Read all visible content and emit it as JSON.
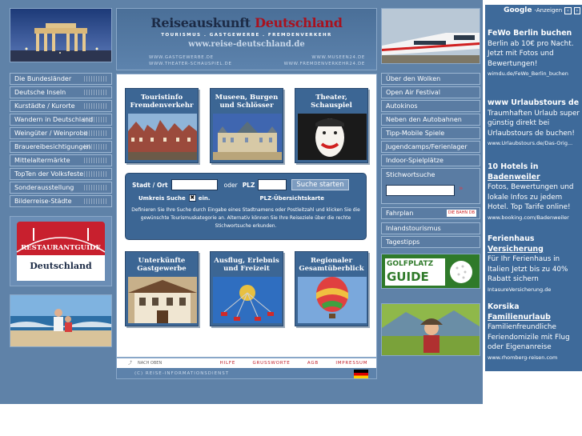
{
  "header": {
    "title_part1": "Reiseauskunft",
    "title_part2": "Deutschland",
    "subtitle": "TOURISMUS . GASTGEWERBE . FREMDENVERKEHR",
    "url": "www.reise-deutschland.de",
    "links": [
      "WWW.GASTGEWERBE.DE",
      "WWW.MUSEEN24.DE",
      "WWW.THEATER-SCHAUSPIEL.DE",
      "WWW.FREMDENVERKEHR24.DE"
    ]
  },
  "left_nav": [
    "Die Bundesländer",
    "Deutsche Inseln",
    "Kurstädte / Kurorte",
    "Wandern in Deutschland",
    "Weingüter / Weinprobe",
    "Brauereibesichtigungen",
    "Mittelaltermärkte",
    "TopTen der Volksfeste",
    "Sonderausstellung",
    "Bilderreise-Städte"
  ],
  "restaurant_guide": {
    "line1": "Restaurantguide",
    "line2": "Deutschland"
  },
  "tiles_top": [
    {
      "title": "Touristinfo Fremdenverkehr"
    },
    {
      "title": "Museen, Burgen und Schlösser"
    },
    {
      "title": "Theater, Schauspiel"
    }
  ],
  "tiles_bottom": [
    {
      "title": "Unterkünfte Gastgewerbe"
    },
    {
      "title": "Ausflug, Erlebnis und Freizeit"
    },
    {
      "title": "Regionaler Gesamtüberblick"
    }
  ],
  "search": {
    "city_label": "Stadt / Ort",
    "or_label": "oder",
    "plz_label": "PLZ",
    "button": "Suche starten",
    "radius_label": "Umkreis Suche",
    "radius_checked": "✖",
    "radius_state": "ein.",
    "plz_map": "PLZ-Übersichtskarte",
    "help": "Definieren Sie Ihre Suche durch Eingabe eines Stadtnamens oder Postleitzahl und klicken Sie die gewünschte Tourismuskategorie an. Alternativ können Sie Ihre Reiseziele über die rechte Stichwortsuche erkunden."
  },
  "footer": {
    "back": "NACH OBEN",
    "links": [
      "HILFE",
      "GRUSSWORTE",
      "AGB",
      "IMPRESSUM"
    ],
    "copyright": "(C) REISE-INFORMATIONSDIENST"
  },
  "right_nav_top": [
    "Über den Wolken",
    "Open Air Festival",
    "Autokinos",
    "Neben den Autobahnen",
    "Tipp-Mobile Spiele",
    "Jugendcamps/Ferienlager",
    "Indoor-Spielplätze"
  ],
  "keyword": {
    "label": "Stichwortsuche"
  },
  "fahrplan": {
    "label": "Fahrplan",
    "badge": "DIE BAHN DB"
  },
  "right_nav_bottom": [
    "Inlandstourismus",
    "Tagestipps"
  ],
  "golf": {
    "line1": "GOLFPLATZ",
    "line2": "GUIDE"
  },
  "ads": {
    "header_brand": "Google",
    "header_label": "-Anzeigen",
    "items": [
      {
        "title_a": "FeWo Berlin buchen",
        "title_b": "",
        "body": "Berlin ab 10€ pro Nacht. Jetzt mit Fotos und Bewertungen!",
        "url": "wimdu.de/FeWo_Berlin_buchen"
      },
      {
        "title_a": "www Urlaubstours de",
        "title_b": "",
        "body": "Traumhaften Urlaub super günstig direkt bei Urlaubstours de buchen!",
        "url": "www.Urlaubstours.de/Das-Orig..."
      },
      {
        "title_a": "10 Hotels in",
        "title_b": "Badenweiler",
        "body": "Fotos, Bewertungen und lokale Infos zu jedem Hotel. Top Tarife online!",
        "url": "www.booking.com/Badenweiler"
      },
      {
        "title_a": "Ferienhaus",
        "title_b": "Versicherung",
        "body": "Für Ihr Ferienhaus in Italien Jetzt bis zu 40% Rabatt sichern",
        "url": "IntasureVersicherung.de"
      },
      {
        "title_a": "Korsika",
        "title_b": "Familienurlaub",
        "body": "Familienfreundliche Feriendomizile mit Flug oder Eigenanreise",
        "url": "www.rhomberg-reisen.com"
      }
    ]
  }
}
